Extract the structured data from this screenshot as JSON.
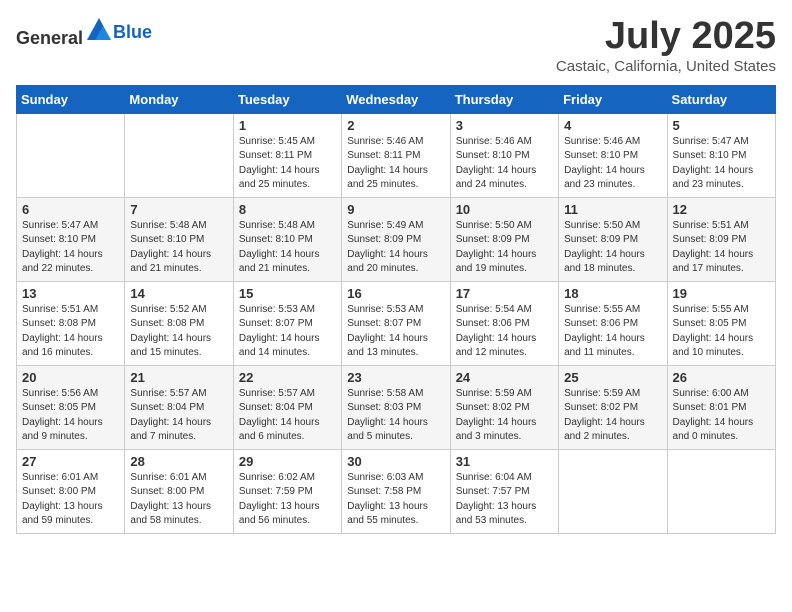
{
  "header": {
    "logo_general": "General",
    "logo_blue": "Blue",
    "title": "July 2025",
    "subtitle": "Castaic, California, United States"
  },
  "weekdays": [
    "Sunday",
    "Monday",
    "Tuesday",
    "Wednesday",
    "Thursday",
    "Friday",
    "Saturday"
  ],
  "weeks": [
    [
      {
        "day": "",
        "info": ""
      },
      {
        "day": "",
        "info": ""
      },
      {
        "day": "1",
        "info": "Sunrise: 5:45 AM\nSunset: 8:11 PM\nDaylight: 14 hours and 25 minutes."
      },
      {
        "day": "2",
        "info": "Sunrise: 5:46 AM\nSunset: 8:11 PM\nDaylight: 14 hours and 25 minutes."
      },
      {
        "day": "3",
        "info": "Sunrise: 5:46 AM\nSunset: 8:10 PM\nDaylight: 14 hours and 24 minutes."
      },
      {
        "day": "4",
        "info": "Sunrise: 5:46 AM\nSunset: 8:10 PM\nDaylight: 14 hours and 23 minutes."
      },
      {
        "day": "5",
        "info": "Sunrise: 5:47 AM\nSunset: 8:10 PM\nDaylight: 14 hours and 23 minutes."
      }
    ],
    [
      {
        "day": "6",
        "info": "Sunrise: 5:47 AM\nSunset: 8:10 PM\nDaylight: 14 hours and 22 minutes."
      },
      {
        "day": "7",
        "info": "Sunrise: 5:48 AM\nSunset: 8:10 PM\nDaylight: 14 hours and 21 minutes."
      },
      {
        "day": "8",
        "info": "Sunrise: 5:48 AM\nSunset: 8:10 PM\nDaylight: 14 hours and 21 minutes."
      },
      {
        "day": "9",
        "info": "Sunrise: 5:49 AM\nSunset: 8:09 PM\nDaylight: 14 hours and 20 minutes."
      },
      {
        "day": "10",
        "info": "Sunrise: 5:50 AM\nSunset: 8:09 PM\nDaylight: 14 hours and 19 minutes."
      },
      {
        "day": "11",
        "info": "Sunrise: 5:50 AM\nSunset: 8:09 PM\nDaylight: 14 hours and 18 minutes."
      },
      {
        "day": "12",
        "info": "Sunrise: 5:51 AM\nSunset: 8:09 PM\nDaylight: 14 hours and 17 minutes."
      }
    ],
    [
      {
        "day": "13",
        "info": "Sunrise: 5:51 AM\nSunset: 8:08 PM\nDaylight: 14 hours and 16 minutes."
      },
      {
        "day": "14",
        "info": "Sunrise: 5:52 AM\nSunset: 8:08 PM\nDaylight: 14 hours and 15 minutes."
      },
      {
        "day": "15",
        "info": "Sunrise: 5:53 AM\nSunset: 8:07 PM\nDaylight: 14 hours and 14 minutes."
      },
      {
        "day": "16",
        "info": "Sunrise: 5:53 AM\nSunset: 8:07 PM\nDaylight: 14 hours and 13 minutes."
      },
      {
        "day": "17",
        "info": "Sunrise: 5:54 AM\nSunset: 8:06 PM\nDaylight: 14 hours and 12 minutes."
      },
      {
        "day": "18",
        "info": "Sunrise: 5:55 AM\nSunset: 8:06 PM\nDaylight: 14 hours and 11 minutes."
      },
      {
        "day": "19",
        "info": "Sunrise: 5:55 AM\nSunset: 8:05 PM\nDaylight: 14 hours and 10 minutes."
      }
    ],
    [
      {
        "day": "20",
        "info": "Sunrise: 5:56 AM\nSunset: 8:05 PM\nDaylight: 14 hours and 9 minutes."
      },
      {
        "day": "21",
        "info": "Sunrise: 5:57 AM\nSunset: 8:04 PM\nDaylight: 14 hours and 7 minutes."
      },
      {
        "day": "22",
        "info": "Sunrise: 5:57 AM\nSunset: 8:04 PM\nDaylight: 14 hours and 6 minutes."
      },
      {
        "day": "23",
        "info": "Sunrise: 5:58 AM\nSunset: 8:03 PM\nDaylight: 14 hours and 5 minutes."
      },
      {
        "day": "24",
        "info": "Sunrise: 5:59 AM\nSunset: 8:02 PM\nDaylight: 14 hours and 3 minutes."
      },
      {
        "day": "25",
        "info": "Sunrise: 5:59 AM\nSunset: 8:02 PM\nDaylight: 14 hours and 2 minutes."
      },
      {
        "day": "26",
        "info": "Sunrise: 6:00 AM\nSunset: 8:01 PM\nDaylight: 14 hours and 0 minutes."
      }
    ],
    [
      {
        "day": "27",
        "info": "Sunrise: 6:01 AM\nSunset: 8:00 PM\nDaylight: 13 hours and 59 minutes."
      },
      {
        "day": "28",
        "info": "Sunrise: 6:01 AM\nSunset: 8:00 PM\nDaylight: 13 hours and 58 minutes."
      },
      {
        "day": "29",
        "info": "Sunrise: 6:02 AM\nSunset: 7:59 PM\nDaylight: 13 hours and 56 minutes."
      },
      {
        "day": "30",
        "info": "Sunrise: 6:03 AM\nSunset: 7:58 PM\nDaylight: 13 hours and 55 minutes."
      },
      {
        "day": "31",
        "info": "Sunrise: 6:04 AM\nSunset: 7:57 PM\nDaylight: 13 hours and 53 minutes."
      },
      {
        "day": "",
        "info": ""
      },
      {
        "day": "",
        "info": ""
      }
    ]
  ]
}
